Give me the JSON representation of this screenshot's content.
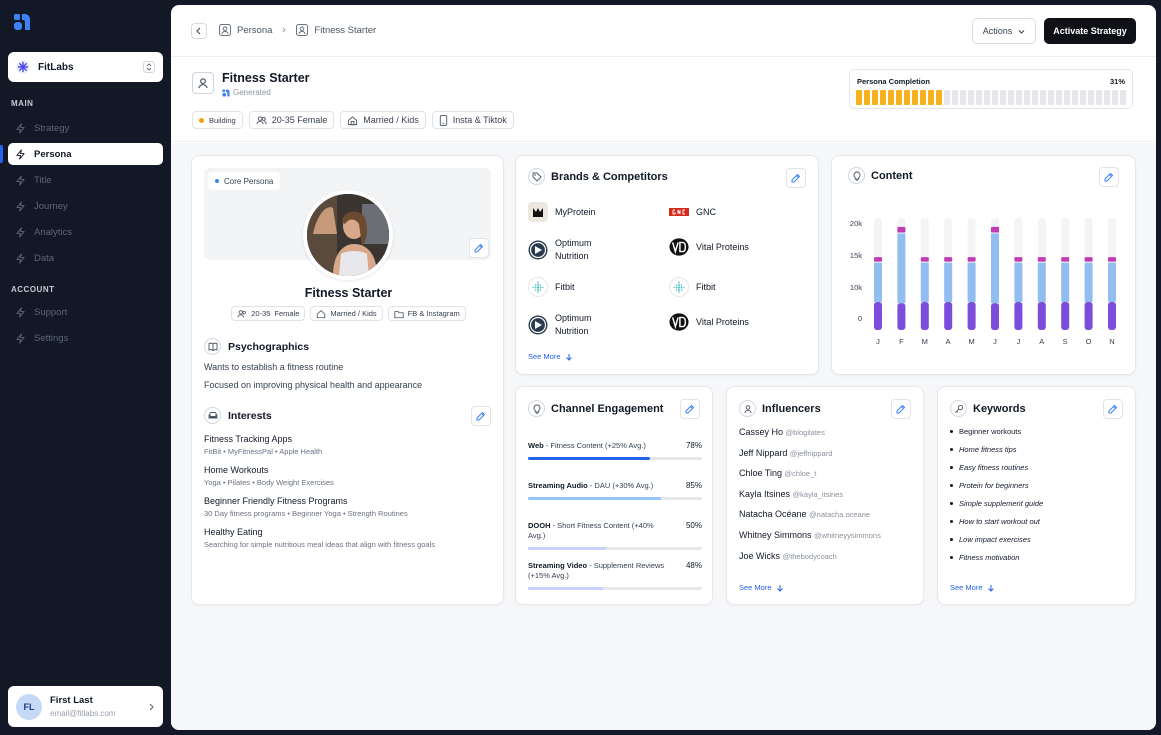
{
  "sidebar": {
    "org_name": "FitLabs",
    "section_main": "MAIN",
    "section_account": "ACCOUNT",
    "nav": [
      {
        "label": "Strategy",
        "icon": "bolt-icon"
      },
      {
        "label": "Persona",
        "icon": "bolt-icon",
        "active": true
      },
      {
        "label": "Title",
        "icon": "bolt-icon"
      },
      {
        "label": "Journey",
        "icon": "bolt-icon"
      },
      {
        "label": "Analytics",
        "icon": "bolt-icon"
      },
      {
        "label": "Data",
        "icon": "bolt-icon"
      }
    ],
    "account_nav": [
      {
        "label": "Support",
        "icon": "bolt-icon"
      },
      {
        "label": "Settings",
        "icon": "bolt-icon"
      }
    ],
    "user": {
      "initials": "FL",
      "name": "First Last",
      "email": "email@fitlabs.com"
    }
  },
  "topbar": {
    "crumbs": [
      "Persona",
      "Fitness Starter"
    ],
    "actions_label": "Actions",
    "activate_label": "Activate Strategy"
  },
  "header": {
    "title": "Fitness Starter",
    "subtitle": "Generated",
    "tags": [
      "Building",
      "20-35 Female",
      "Married / Kids",
      "Insta & Tiktok"
    ],
    "completion_label": "Persona Completion",
    "completion_pct": "31%",
    "completion_fraction": 0.31
  },
  "persona": {
    "badge": "Core Persona",
    "name": "Fitness Starter",
    "tags": [
      "20-35",
      "Female",
      "Married / Kids",
      "FB & Instagram"
    ],
    "psych_title": "Psychographics",
    "psych": [
      "Wants to establish a fitness routine",
      "Focused on improving physical health and appearance"
    ],
    "interests_title": "Interests",
    "interests": [
      {
        "title": "Fitness Tracking Apps",
        "sub": "FitBit • MyFitnessPal • Apple Health"
      },
      {
        "title": "Home Workouts",
        "sub": "Yoga • Pilates • Body Weight Exercises"
      },
      {
        "title": "Beginner Friendly Fitness Programs",
        "sub": "30 Day fitness programs • Beginner Yoga • Strength Routines"
      },
      {
        "title": "Healthy Eating",
        "sub": "Searching for simple nutritious meal ideas that align with fitness goals"
      }
    ]
  },
  "brands": {
    "title": "Brands & Competitors",
    "items": [
      "MyProtein",
      "GNC",
      "Optimum Nutrition",
      "Vital Proteins",
      "Fitbit",
      "Fitbit",
      "Optimum Nutrition",
      "Vital Proteins"
    ],
    "see_more": "See More"
  },
  "content_card": {
    "title": "Content"
  },
  "chart_data": {
    "type": "bar",
    "stacked": true,
    "categories": [
      "J",
      "F",
      "M",
      "A",
      "M",
      "J",
      "J",
      "A",
      "S",
      "O",
      "N"
    ],
    "yticks": [
      "20k",
      "15k",
      "10k",
      "0"
    ],
    "ylim": [
      0,
      20000
    ],
    "series": [
      {
        "values": [
          5000,
          4800,
          5000,
          5000,
          5000,
          4800,
          5000,
          5000,
          5000,
          5000,
          5000
        ],
        "color": "#7c4ddb"
      },
      {
        "values": [
          7200,
          12600,
          7200,
          7200,
          7200,
          12600,
          7200,
          7200,
          7200,
          7200,
          7200
        ],
        "color": "#92bdf0"
      },
      {
        "values": [
          1000,
          1200,
          1000,
          1000,
          1000,
          1200,
          1000,
          1000,
          1000,
          1000,
          1000
        ],
        "color": "#c13cb3"
      }
    ]
  },
  "channel": {
    "title": "Channel Engagement",
    "items": [
      {
        "name": "Web",
        "desc": " - Fitness Content (+25% Avg.)",
        "pct": "78%",
        "value": 0.78,
        "color": "#2563eb"
      },
      {
        "name": "Streaming Audio",
        "desc": " - DAU (+30% Avg.)",
        "pct": "85%",
        "value": 0.85,
        "color": "#93c5fd"
      },
      {
        "name": "DOOH",
        "desc": " - Short Fitness Content (+40% Avg.)",
        "pct": "50%",
        "value": 0.5,
        "color": "#c7d2fe"
      },
      {
        "name": "Streaming Video",
        "desc": " - Supplement Reviews (+15% Avg.)",
        "pct": "48%",
        "value": 0.48,
        "color": "#c7d2fe"
      }
    ]
  },
  "influencers": {
    "title": "Influencers",
    "items": [
      {
        "name": "Cassey Ho",
        "handle": "@blogilates"
      },
      {
        "name": "Jeff Nippard",
        "handle": "@jeffnippard"
      },
      {
        "name": "Chloe Ting",
        "handle": "@chloe_t"
      },
      {
        "name": "Kayla Itsines",
        "handle": "@kayla_itsines"
      },
      {
        "name": "Natacha Océane",
        "handle": "@natacha.oceane"
      },
      {
        "name": "Whitney Simmons",
        "handle": "@whitneyysimmons"
      },
      {
        "name": "Joe Wicks",
        "handle": "@thebodycoach"
      }
    ],
    "see_more": "See More"
  },
  "keywords": {
    "title": "Keywords",
    "items": [
      "Beginner workouts",
      "Home fitness tips",
      "Easy fitness routines",
      "Protein for beginners",
      "Simple supplement guide",
      "How to start workout out",
      "Low impact exercises",
      "Fitness motivation"
    ],
    "see_more": "See More"
  }
}
